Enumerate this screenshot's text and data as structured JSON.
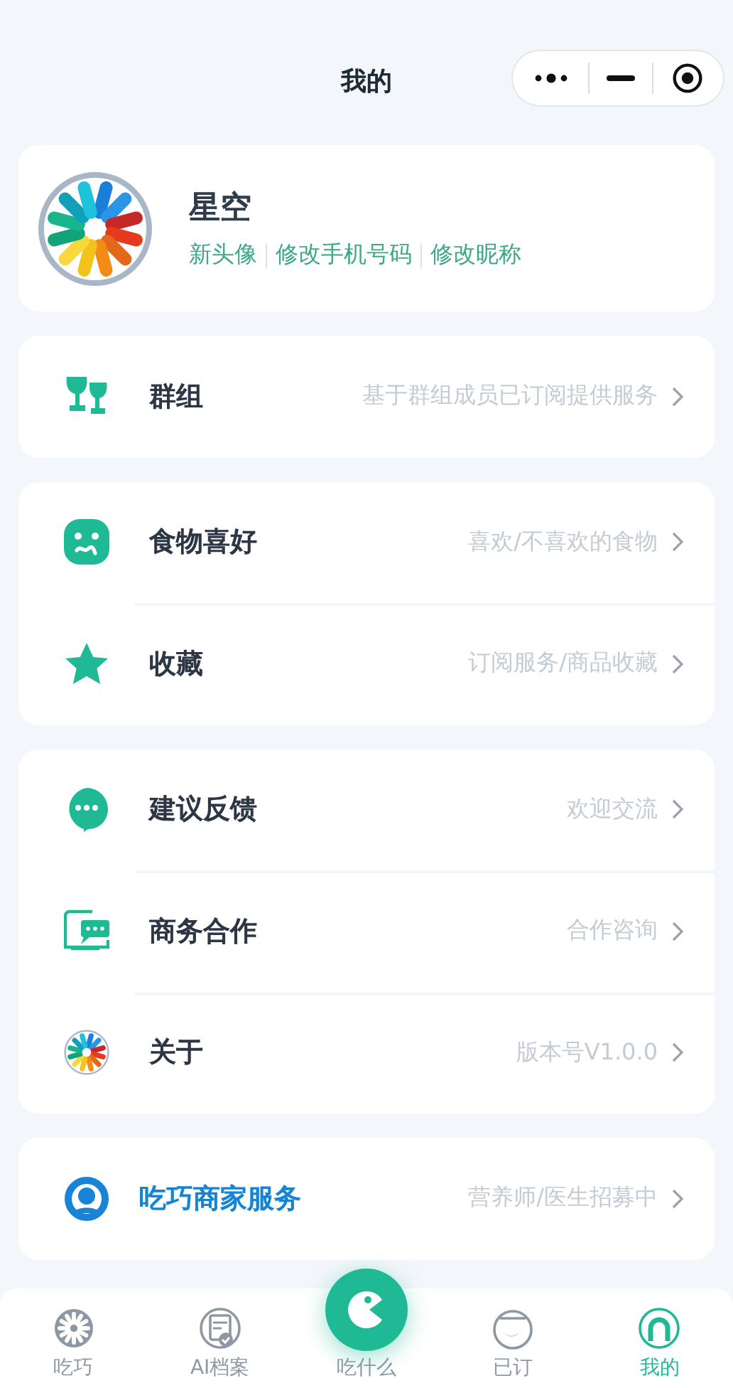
{
  "title": "我的",
  "profile": {
    "name": "星空",
    "links": [
      "新头像",
      "修改手机号码",
      "修改昵称"
    ]
  },
  "groups": [
    [
      {
        "label": "群组",
        "hint": "基于群组成员已订阅提供服务",
        "kind": "normal"
      }
    ],
    [
      {
        "label": "食物喜好",
        "hint": "喜欢/不喜欢的食物",
        "kind": "normal"
      },
      {
        "label": "收藏",
        "hint": "订阅服务/商品收藏",
        "kind": "normal"
      }
    ],
    [
      {
        "label": "建议反馈",
        "hint": "欢迎交流",
        "kind": "normal"
      },
      {
        "label": "商务合作",
        "hint": "合作咨询",
        "kind": "normal"
      },
      {
        "label": "关于",
        "hint": "版本号V1.0.0",
        "kind": "normal"
      }
    ],
    [
      {
        "label": "吃巧商家服务",
        "hint": "营养师/医生招募中",
        "kind": "featured"
      }
    ]
  ],
  "tabs": [
    {
      "label": "吃巧",
      "selected": false,
      "kind": "normal"
    },
    {
      "label": "AI档案",
      "selected": false,
      "kind": "normal"
    },
    {
      "label": "吃什么",
      "selected": false,
      "kind": "center"
    },
    {
      "label": "已订",
      "selected": false,
      "kind": "normal"
    },
    {
      "label": "我的",
      "selected": true,
      "kind": "normal"
    }
  ]
}
